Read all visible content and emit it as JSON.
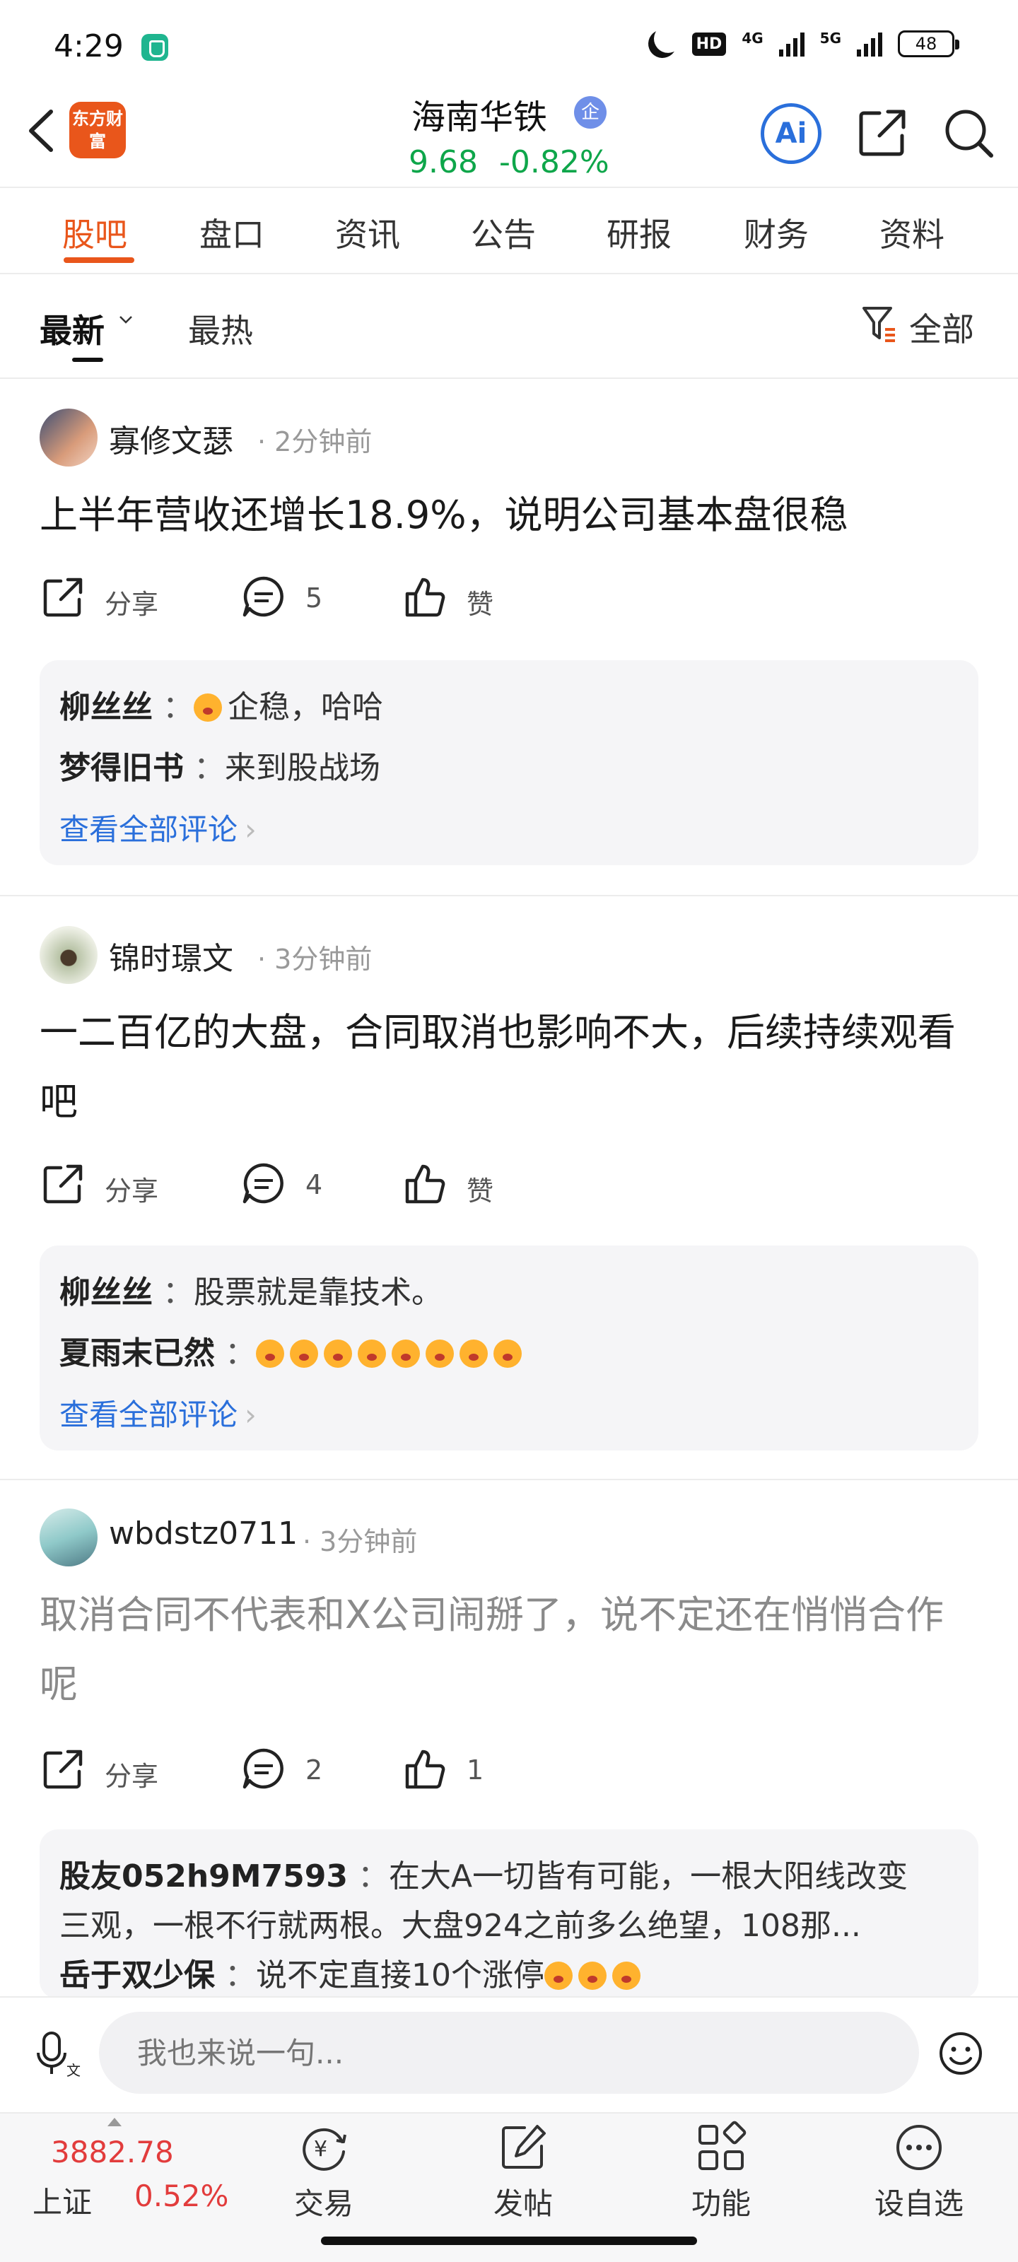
{
  "status_bar": {
    "time": "4:29",
    "hd": "HD",
    "net1": "4G",
    "net2": "5G",
    "battery": "48"
  },
  "header": {
    "app_logo_text": "东方财富",
    "stock_name": "海南华铁",
    "verify_badge": "企",
    "price": "9.68",
    "change": "-0.82%",
    "ai_label": "Ai",
    "icons": [
      "back-icon",
      "share-icon",
      "search-icon"
    ]
  },
  "tabs": [
    {
      "label": "股吧",
      "active": true
    },
    {
      "label": "盘口"
    },
    {
      "label": "资讯"
    },
    {
      "label": "公告"
    },
    {
      "label": "研报"
    },
    {
      "label": "财务"
    },
    {
      "label": "资料"
    }
  ],
  "sort": {
    "newest": "最新",
    "hottest": "最热",
    "filter": "全部"
  },
  "posts": [
    {
      "user": "寡修文瑟",
      "time": "· 2分钟前",
      "text": "上半年营收还增长18.9%，说明公司基本盘很稳",
      "share_label": "分享",
      "comments": "5",
      "likes": "赞",
      "replies": [
        {
          "user": "柳丝丝",
          "text": "企稳，哈哈"
        },
        {
          "user": "梦得旧书",
          "text": "来到股战场"
        }
      ],
      "view_all": "查看全部评论"
    },
    {
      "user": "锦时璟文",
      "time": "· 3分钟前",
      "text": "一二百亿的大盘，合同取消也影响不大，后续持续观看吧",
      "share_label": "分享",
      "comments": "4",
      "likes": "赞",
      "replies": [
        {
          "user": "柳丝丝",
          "text": "股票就是靠技术。"
        },
        {
          "user": "夏雨末已然",
          "text": ""
        }
      ],
      "view_all": "查看全部评论"
    },
    {
      "user": "wbdstz0711",
      "time": "· 3分钟前",
      "text": "取消合同不代表和X公司闹掰了，说不定还在悄悄合作呢",
      "share_label": "分享",
      "comments": "2",
      "likes": "1",
      "replies": [
        {
          "user": "股友052h9M7593",
          "text": "在大A一切皆有可能，一根大阳线改变"
        },
        {
          "user": "",
          "text": "三观，一根不行就两根。大盘924之前多么绝望，108那..."
        },
        {
          "user": "岳于双少保",
          "text": "说不定直接10个涨停"
        }
      ]
    }
  ],
  "input": {
    "placeholder": "我也来说一句..."
  },
  "bottom_nav": {
    "index_value": "3882.78",
    "index_name": "上证",
    "index_change": "0.52%",
    "items": [
      {
        "label": "交易",
        "icon": "yen-cycle-icon"
      },
      {
        "label": "发帖",
        "icon": "edit-icon"
      },
      {
        "label": "功能",
        "icon": "grid-icon"
      },
      {
        "label": "设自选",
        "icon": "more-icon"
      }
    ]
  },
  "colors": {
    "accent": "#e9561b",
    "price_down": "#0ea64a",
    "price_up": "#e23c3c",
    "link": "#2a6fdb"
  }
}
